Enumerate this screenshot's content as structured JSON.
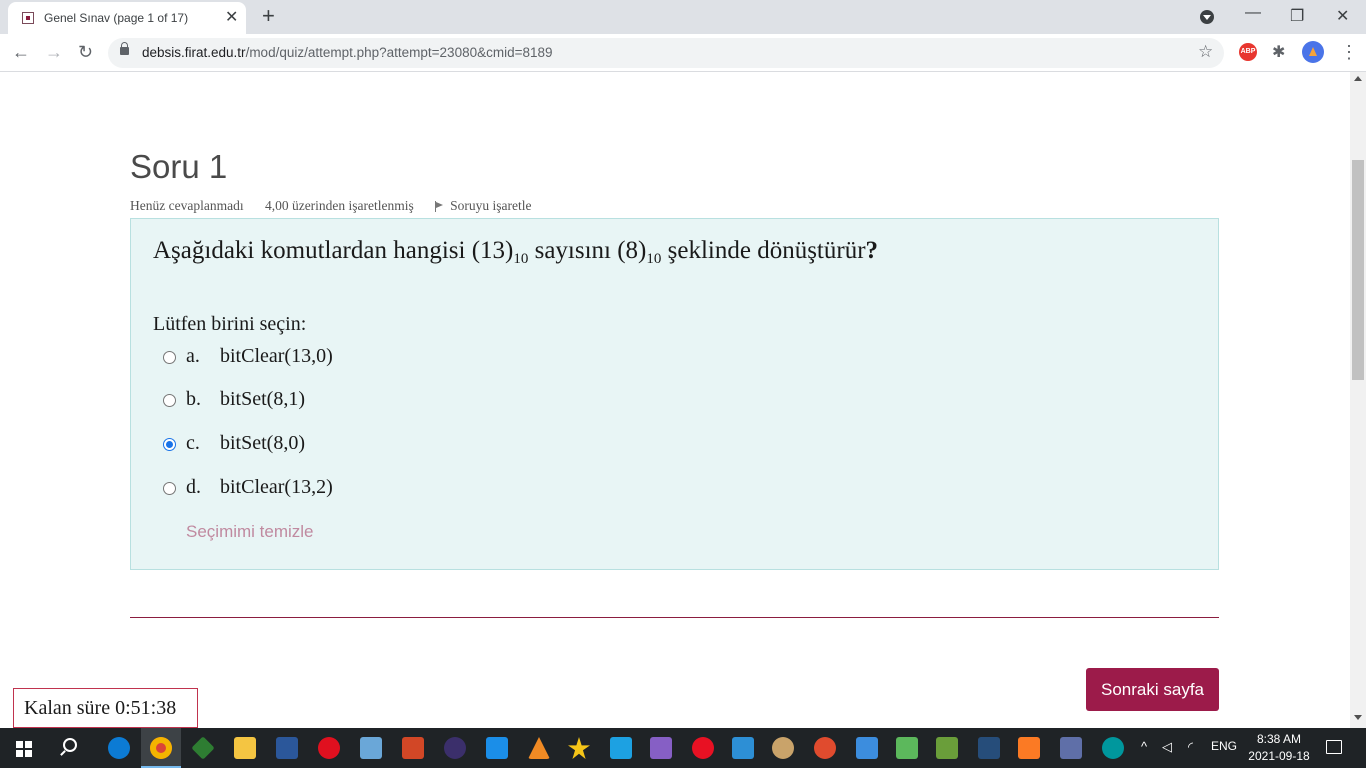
{
  "browser": {
    "tab_title": "Genel Sınav (page 1 of 17)",
    "tab_close": "✕",
    "new_tab": "+",
    "url_host": "debsis.firat.edu.tr",
    "url_rest": "/mod/quiz/attempt.php?attempt=23080&cmid=8189",
    "ext_abp": "ABP"
  },
  "question": {
    "heading": "Soru 1",
    "status": "Henüz cevaplanmadı",
    "marks": "4,00 üzerinden işaretlenmiş",
    "flag_label": "Soruyu işaretle",
    "text_before": "Aşağıdaki komutlardan hangisi (13)",
    "sub1": "10",
    "text_mid": " sayısını (8)",
    "sub2": "10",
    "text_after": " şeklinde dönüştürür",
    "text_qmark": "?",
    "prompt": "Lütfen birini seçin:",
    "options": [
      {
        "letter": "a.",
        "text": "bitClear(13,0)",
        "checked": false
      },
      {
        "letter": "b.",
        "text": "bitSet(8,1)",
        "checked": false
      },
      {
        "letter": "c.",
        "text": "bitSet(8,0)",
        "checked": true
      },
      {
        "letter": "d.",
        "text": "bitClear(13,2)",
        "checked": false
      }
    ],
    "clear_choice": "Seçimimi temizle"
  },
  "navigation": {
    "next_page": "Sonraki sayfa"
  },
  "timer": {
    "label": "Kalan süre ",
    "value": "0:51:38"
  },
  "taskbar": {
    "lang": "ENG",
    "time": "8:38 AM",
    "date": "2021-09-18"
  },
  "colors": {
    "accent": "#9c1b4a",
    "question_bg": "#e8f5f5",
    "radio_checked": "#1a73e8"
  }
}
